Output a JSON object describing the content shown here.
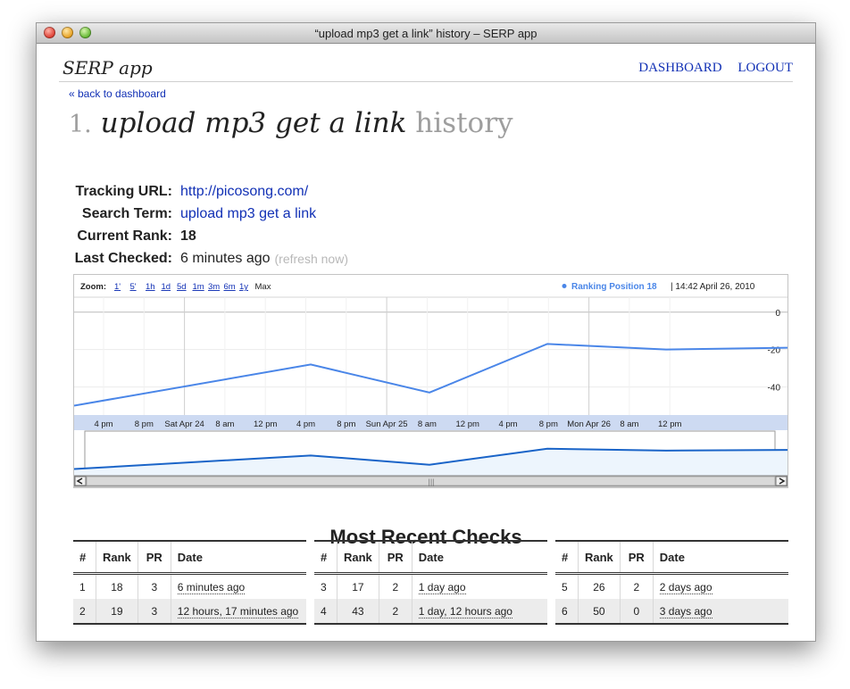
{
  "window": {
    "title": "“upload mp3 get a link” history – SERP app"
  },
  "nav": {
    "brand": "SERP app",
    "dashboard": "DASHBOARD",
    "logout": "LOGOUT",
    "back": "« back to dashboard"
  },
  "heading": {
    "number": "1.",
    "query": "upload mp3 get a link",
    "suffix": "history"
  },
  "info": {
    "tracking_label": "Tracking URL:",
    "tracking_value": "http://picosong.com/",
    "term_label": "Search Term:",
    "term_value": "upload mp3 get a link",
    "rank_label": "Current Rank:",
    "rank_value": "18",
    "checked_label": "Last Checked:",
    "checked_value": "6 minutes ago",
    "refresh": "(refresh now)"
  },
  "chart": {
    "zoom_label": "Zoom:",
    "zoom_options": [
      "1'",
      "5'",
      "1h",
      "1d",
      "5d",
      "1m",
      "3m",
      "6m",
      "1y",
      "Max"
    ],
    "legend_series": "Ranking Position 18",
    "legend_time": "| 14:42 April 26, 2010",
    "series_color": "#4a86e8",
    "nav_color": "#1a64c8"
  },
  "chart_data": {
    "type": "line",
    "y_ticks": [
      0,
      -20,
      -40
    ],
    "ylim": [
      -55,
      8
    ],
    "x_labels": [
      "4 pm",
      "8 pm",
      "Sat Apr 24",
      "8 am",
      "12 pm",
      "4 pm",
      "8 pm",
      "Sun Apr 25",
      "8 am",
      "12 pm",
      "4 pm",
      "8 pm",
      "Mon Apr 26",
      "8 am",
      "12 pm"
    ],
    "series": [
      {
        "name": "Ranking Position",
        "values": [
          -50,
          -28,
          -43,
          -17,
          -20,
          -19
        ]
      }
    ]
  },
  "recent": {
    "title": "Most Recent Checks",
    "headers": [
      "#",
      "Rank",
      "PR",
      "Date"
    ],
    "tables": [
      {
        "rows": [
          {
            "n": "1",
            "rank": "18",
            "pr": "3",
            "date": "6 minutes ago"
          },
          {
            "n": "2",
            "rank": "19",
            "pr": "3",
            "date": "12 hours, 17 minutes ago"
          }
        ]
      },
      {
        "rows": [
          {
            "n": "3",
            "rank": "17",
            "pr": "2",
            "date": "1 day ago"
          },
          {
            "n": "4",
            "rank": "43",
            "pr": "2",
            "date": "1 day, 12 hours ago"
          }
        ]
      },
      {
        "rows": [
          {
            "n": "5",
            "rank": "26",
            "pr": "2",
            "date": "2 days ago"
          },
          {
            "n": "6",
            "rank": "50",
            "pr": "0",
            "date": "3 days ago"
          }
        ]
      }
    ]
  }
}
